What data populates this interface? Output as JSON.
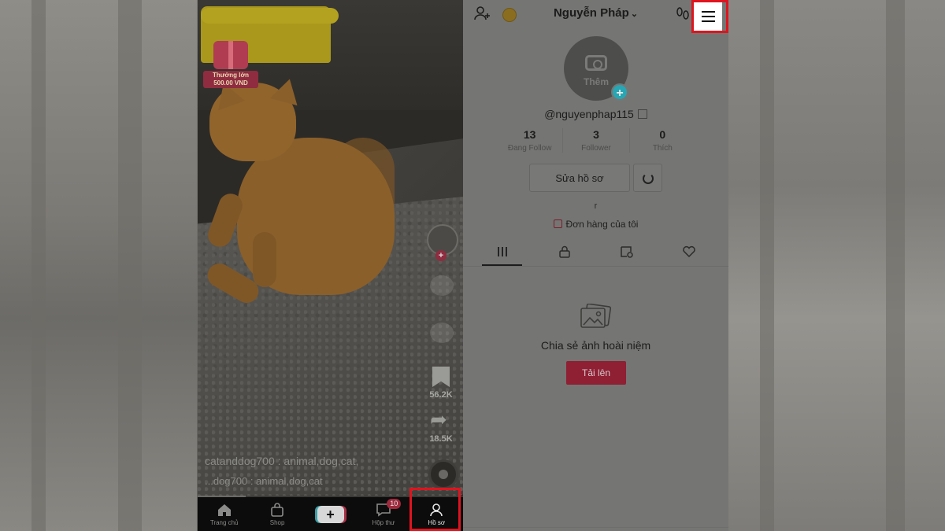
{
  "video": {
    "promo_label": "Thưởng lớn 500.00 VND",
    "likes_count": "56.2K",
    "shares_count": "18.5K",
    "caption_main": "catanddog700 : animal,dog,cat,",
    "caption_secondary": "...dog700 : animal,dog,cat",
    "progress": 0.18
  },
  "bottom_nav": {
    "items": [
      {
        "label": "Trang chủ",
        "icon": "home-icon"
      },
      {
        "label": "Shop",
        "icon": "shop-bag-icon"
      },
      {
        "label": "",
        "icon": "plus-icon"
      },
      {
        "label": "Hộp thư",
        "icon": "inbox-icon",
        "badge": "10"
      },
      {
        "label": "Hồ sơ",
        "icon": "profile-icon"
      }
    ],
    "active_index": 4
  },
  "profile": {
    "username": "Nguyễn Pháp",
    "username_chevron": "⌄",
    "avatar_add_label": "Thêm",
    "handle": "@nguyenphap115",
    "stats": [
      {
        "value": "13",
        "label": "Đang Follow"
      },
      {
        "value": "3",
        "label": "Follower"
      },
      {
        "value": "0",
        "label": "Thích"
      }
    ],
    "edit_profile_label": "Sửa hồ sơ",
    "bio": "r",
    "orders_label": "Đơn hàng của tôi",
    "tabs": [
      {
        "icon": "grid-icon",
        "active": true
      },
      {
        "icon": "lock-icon",
        "active": false
      },
      {
        "icon": "repost-icon",
        "active": false
      },
      {
        "icon": "liked-icon",
        "active": false
      }
    ],
    "empty_state_title": "Chia sẻ ảnh hoài niệm",
    "upload_label": "Tải lên"
  },
  "colors": {
    "highlight": "#e0141e",
    "upload_button": "#8f1f33",
    "avatar_plus": "#27a6b4"
  }
}
